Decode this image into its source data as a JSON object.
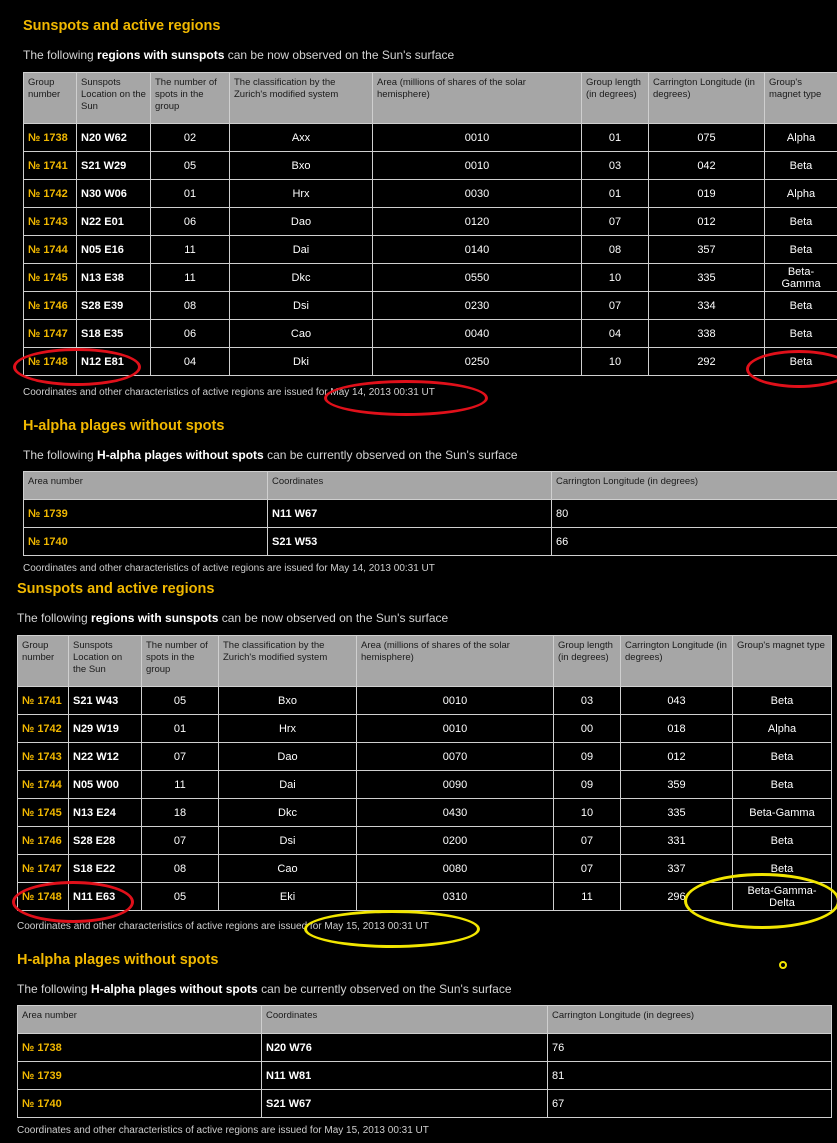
{
  "sunspots_title": "Sunspots and active regions",
  "sunspots_intro": {
    "pre": "The following ",
    "bold": "regions with sunspots",
    "post": " can be now observed on the Sun's surface"
  },
  "plages_title": "H-alpha plages without spots",
  "plages_intro": {
    "pre": "The following ",
    "bold": "H-alpha plages without spots",
    "post": " can be currently observed on the Sun's surface"
  },
  "sunspot_headers": [
    "Group number",
    "Sunspots Location on the Sun",
    "The number of spots in the group",
    "The classification by the Zurich's modified system",
    "Area (millions of shares of the solar hemisphere)",
    "Group length (in degrees)",
    "Carrington Longitude (in degrees)",
    "Group's magnet type"
  ],
  "plage_headers": [
    "Area number",
    "Coordinates",
    "Carrington Longitude (in degrees)"
  ],
  "report1": {
    "sunspots": [
      [
        "№ 1738",
        "N20 W62",
        "02",
        "Axx",
        "0010",
        "01",
        "075",
        "Alpha"
      ],
      [
        "№ 1741",
        "S21 W29",
        "05",
        "Bxo",
        "0010",
        "03",
        "042",
        "Beta"
      ],
      [
        "№ 1742",
        "N30 W06",
        "01",
        "Hrx",
        "0030",
        "01",
        "019",
        "Alpha"
      ],
      [
        "№ 1743",
        "N22 E01",
        "06",
        "Dao",
        "0120",
        "07",
        "012",
        "Beta"
      ],
      [
        "№ 1744",
        "N05 E16",
        "11",
        "Dai",
        "0140",
        "08",
        "357",
        "Beta"
      ],
      [
        "№ 1745",
        "N13 E38",
        "11",
        "Dkc",
        "0550",
        "10",
        "335",
        "Beta-Gamma"
      ],
      [
        "№ 1746",
        "S28 E39",
        "08",
        "Dsi",
        "0230",
        "07",
        "334",
        "Beta"
      ],
      [
        "№ 1747",
        "S18 E35",
        "06",
        "Cao",
        "0040",
        "04",
        "338",
        "Beta"
      ],
      [
        "№ 1748",
        "N12 E81",
        "04",
        "Dki",
        "0250",
        "10",
        "292",
        "Beta"
      ]
    ],
    "sunspots_footer": "Coordinates and other characteristics of active regions are issued for May 14, 2013 00:31 UT",
    "plages": [
      [
        "№ 1739",
        "N11 W67",
        "80"
      ],
      [
        "№ 1740",
        "S21 W53",
        "66"
      ]
    ],
    "plages_footer": "Coordinates and other characteristics of active regions are issued for May 14, 2013 00:31 UT"
  },
  "report2": {
    "sunspots": [
      [
        "№ 1741",
        "S21 W43",
        "05",
        "Bxo",
        "0010",
        "03",
        "043",
        "Beta"
      ],
      [
        "№ 1742",
        "N29 W19",
        "01",
        "Hrx",
        "0010",
        "00",
        "018",
        "Alpha"
      ],
      [
        "№ 1743",
        "N22 W12",
        "07",
        "Dao",
        "0070",
        "09",
        "012",
        "Beta"
      ],
      [
        "№ 1744",
        "N05 W00",
        "11",
        "Dai",
        "0090",
        "09",
        "359",
        "Beta"
      ],
      [
        "№ 1745",
        "N13 E24",
        "18",
        "Dkc",
        "0430",
        "10",
        "335",
        "Beta-Gamma"
      ],
      [
        "№ 1746",
        "S28 E28",
        "07",
        "Dsi",
        "0200",
        "07",
        "331",
        "Beta"
      ],
      [
        "№ 1747",
        "S18 E22",
        "08",
        "Cao",
        "0080",
        "07",
        "337",
        "Beta"
      ],
      [
        "№ 1748",
        "N11 E63",
        "05",
        "Eki",
        "0310",
        "11",
        "296",
        "Beta-Gamma-Delta"
      ]
    ],
    "sunspots_footer": "Coordinates and other characteristics of active regions are issued for May 15, 2013 00:31 UT",
    "plages": [
      [
        "№ 1738",
        "N20 W76",
        "76"
      ],
      [
        "№ 1739",
        "N11 W81",
        "81"
      ],
      [
        "№ 1740",
        "S21 W67",
        "67"
      ]
    ],
    "plages_footer": "Coordinates and other characteristics of active regions are issued for May 15, 2013 00:31 UT"
  },
  "annotation_colors": {
    "red": "#e0101a",
    "yellow": "#f2e600"
  }
}
